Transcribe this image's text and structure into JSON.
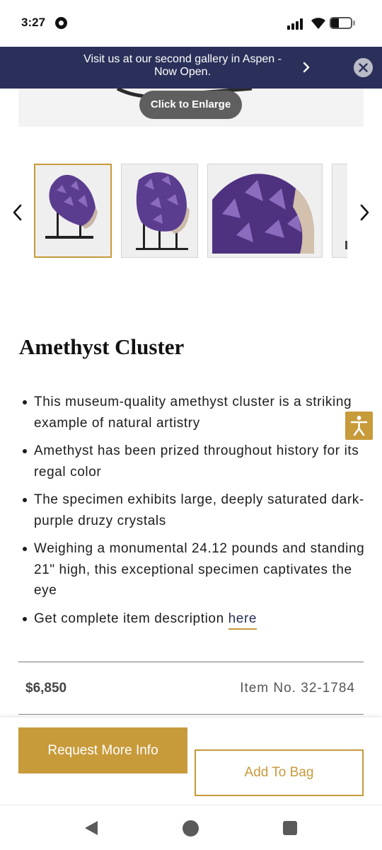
{
  "status_bar": {
    "time": "3:27",
    "battery_level": 0.4
  },
  "banner": {
    "text": "Visit us at our second gallery in Aspen - Now Open.",
    "icons": [
      "chevron-right-icon",
      "close-icon"
    ]
  },
  "gallery": {
    "enlarge_label": "Click to Enlarge",
    "thumbnails_count_visible": 4,
    "active_thumbnail": 1
  },
  "product": {
    "title": "Amethyst Cluster",
    "bullets": [
      "This museum-quality amethyst cluster is a striking example of natural artistry",
      "Amethyst has been prized throughout history for its regal color",
      "The specimen exhibits large, deeply saturated dark-purple druzy crystals",
      "Weighing a monumental 24.12 pounds and standing 21\" high, this exceptional specimen captivates the eye"
    ],
    "description_prefix": "Get complete item description",
    "description_link": "here",
    "price": "$6,850",
    "item_number": "Item No. 32-1784"
  },
  "actions": {
    "request_info": "Request More Info",
    "add_to_bag": "Add To Bag"
  },
  "colors": {
    "banner_bg": "#2a3059",
    "accent_gold": "#c79a3a",
    "amethyst": "#5b3d8f"
  }
}
